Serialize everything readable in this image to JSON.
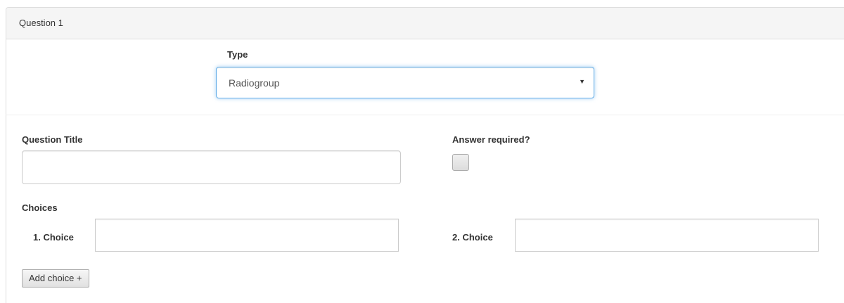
{
  "panel": {
    "heading": "Question 1"
  },
  "type_field": {
    "label": "Type",
    "selected": "Radiogroup"
  },
  "question_title": {
    "label": "Question Title",
    "value": ""
  },
  "answer_required": {
    "label": "Answer required?",
    "checked": false
  },
  "choices": {
    "label": "Choices",
    "items": [
      {
        "label": "1. Choice",
        "value": ""
      },
      {
        "label": "2. Choice",
        "value": ""
      }
    ],
    "add_label": "Add choice +"
  },
  "colors": {
    "focus_border": "#66afe9",
    "heading_bg": "#f5f5f5",
    "border": "#dddddd"
  }
}
